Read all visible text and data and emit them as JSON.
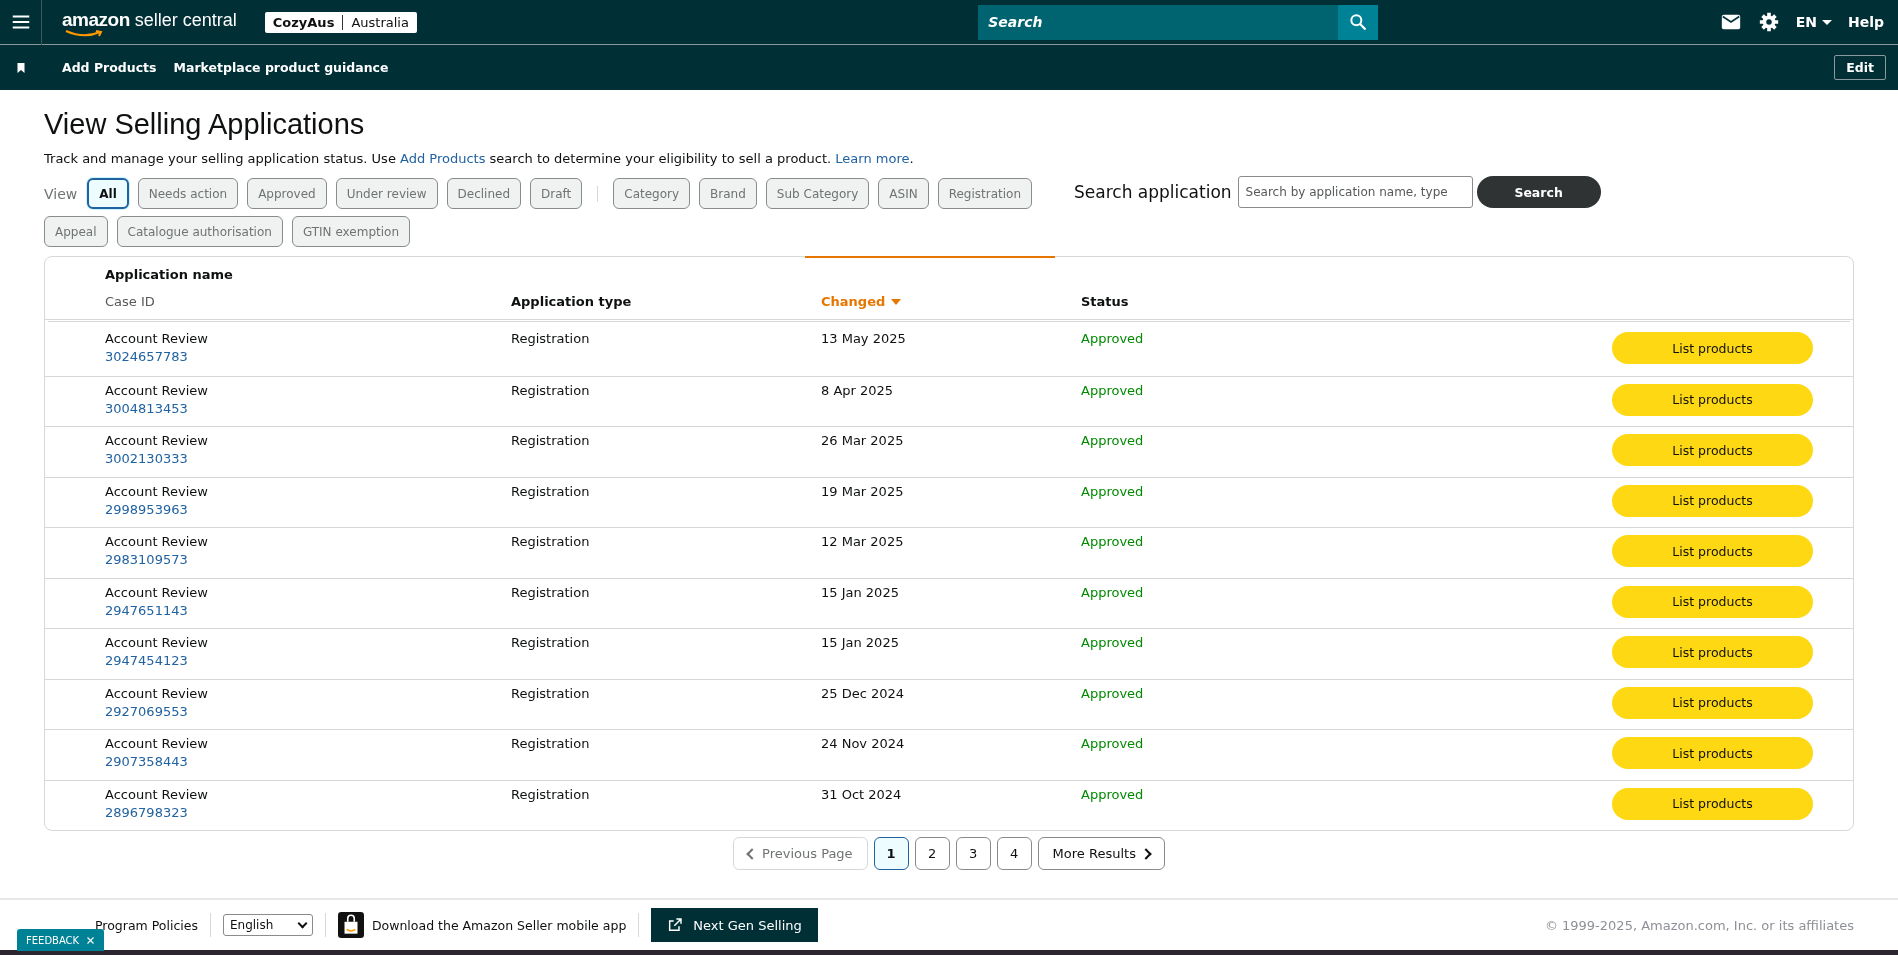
{
  "topbar": {
    "logo_word": "amazon",
    "logo_rest": "seller central",
    "store": "CozyAus",
    "marketplace": "Australia",
    "search": {
      "placeholder": "Search"
    },
    "language": "EN",
    "help": "Help"
  },
  "navbar": {
    "items": [
      "Add Products",
      "Marketplace product guidance"
    ],
    "edit": "Edit"
  },
  "title": "View Selling Applications",
  "description": [
    {
      "kind": "text",
      "text": "Track and manage your selling application status. Use "
    },
    {
      "kind": "link",
      "text": "Add Products"
    },
    {
      "kind": "text",
      "text": " search to determine your eligibility to sell a product. "
    },
    {
      "kind": "link",
      "text": "Learn more"
    },
    {
      "kind": "text",
      "text": "."
    }
  ],
  "filters": {
    "label": "View",
    "status": [
      {
        "label": "All",
        "selected": true
      },
      {
        "label": "Needs action",
        "selected": false
      },
      {
        "label": "Approved",
        "selected": false
      },
      {
        "label": "Under review",
        "selected": false
      },
      {
        "label": "Declined",
        "selected": false
      },
      {
        "label": "Draft",
        "selected": false
      }
    ],
    "types": [
      {
        "label": "Category",
        "selected": false
      },
      {
        "label": "Brand",
        "selected": false
      },
      {
        "label": "Sub Category",
        "selected": false
      },
      {
        "label": "ASIN",
        "selected": false
      },
      {
        "label": "Registration",
        "selected": false
      },
      {
        "label": "Appeal",
        "selected": false
      },
      {
        "label": "Catalogue authorisation",
        "selected": false
      },
      {
        "label": "GTIN exemption",
        "selected": false
      }
    ],
    "search_label": "Search application",
    "search": {
      "placeholder": "Search by application name, type"
    },
    "search_button": "Search"
  },
  "table": {
    "columns": [
      {
        "label": "Application name",
        "sublabel": "Case ID",
        "sorted": false
      },
      {
        "label": "Application type",
        "sorted": false
      },
      {
        "label": "Changed",
        "sorted": true
      },
      {
        "label": "Status",
        "sorted": false
      }
    ],
    "rows": [
      {
        "name": "Account Review",
        "case_id": "3024657783",
        "type": "Registration",
        "changed": "13 May 2025",
        "status": "Approved",
        "action": "List products"
      },
      {
        "name": "Account Review",
        "case_id": "3004813453",
        "type": "Registration",
        "changed": "8 Apr 2025",
        "status": "Approved",
        "action": "List products"
      },
      {
        "name": "Account Review",
        "case_id": "3002130333",
        "type": "Registration",
        "changed": "26 Mar 2025",
        "status": "Approved",
        "action": "List products"
      },
      {
        "name": "Account Review",
        "case_id": "2998953963",
        "type": "Registration",
        "changed": "19 Mar 2025",
        "status": "Approved",
        "action": "List products"
      },
      {
        "name": "Account Review",
        "case_id": "2983109573",
        "type": "Registration",
        "changed": "12 Mar 2025",
        "status": "Approved",
        "action": "List products"
      },
      {
        "name": "Account Review",
        "case_id": "2947651143",
        "type": "Registration",
        "changed": "15 Jan 2025",
        "status": "Approved",
        "action": "List products"
      },
      {
        "name": "Account Review",
        "case_id": "2947454123",
        "type": "Registration",
        "changed": "15 Jan 2025",
        "status": "Approved",
        "action": "List products"
      },
      {
        "name": "Account Review",
        "case_id": "2927069553",
        "type": "Registration",
        "changed": "25 Dec 2024",
        "status": "Approved",
        "action": "List products"
      },
      {
        "name": "Account Review",
        "case_id": "2907358443",
        "type": "Registration",
        "changed": "24 Nov 2024",
        "status": "Approved",
        "action": "List products"
      },
      {
        "name": "Account Review",
        "case_id": "2896798323",
        "type": "Registration",
        "changed": "31 Oct 2024",
        "status": "Approved",
        "action": "List products"
      }
    ]
  },
  "pagination": {
    "previous": {
      "label": "Previous Page",
      "disabled": true
    },
    "pages": [
      {
        "label": "1",
        "selected": true
      },
      {
        "label": "2",
        "selected": false
      },
      {
        "label": "3",
        "selected": false
      },
      {
        "label": "4",
        "selected": false
      }
    ],
    "next": "More Results"
  },
  "footer": {
    "policies": "Program Policies",
    "language": "English",
    "app": "Download the Amazon Seller mobile app",
    "next_gen": "Next Gen Selling",
    "copyright": "© 1999-2025, Amazon.com, Inc. or its affiliates",
    "feedback": "FEEDBACK"
  }
}
